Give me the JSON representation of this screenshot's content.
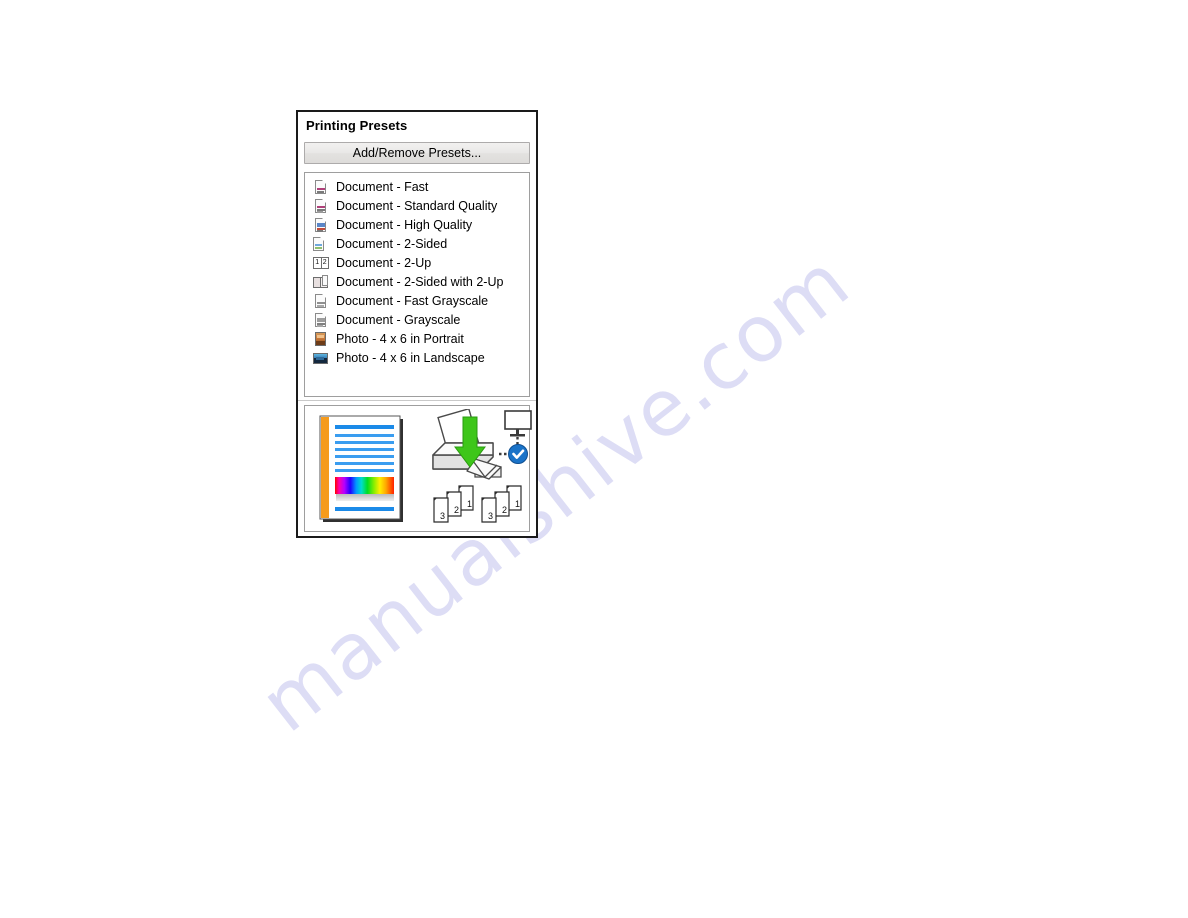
{
  "watermark": {
    "text": "manualshive.com",
    "color": "#ddddf5"
  },
  "dialog": {
    "title": "Printing Presets",
    "add_remove_button_label": "Add/Remove Presets...",
    "presets": [
      {
        "label": "Document - Fast",
        "icon": "document-fast-icon"
      },
      {
        "label": "Document - Standard Quality",
        "icon": "document-standard-quality-icon"
      },
      {
        "label": "Document - High Quality",
        "icon": "document-high-quality-icon"
      },
      {
        "label": "Document - 2-Sided",
        "icon": "document-2-sided-icon"
      },
      {
        "label": "Document - 2-Up",
        "icon": "document-2-up-icon"
      },
      {
        "label": "Document - 2-Sided with 2-Up",
        "icon": "document-2-sided-with-2-up-icon"
      },
      {
        "label": "Document - Fast Grayscale",
        "icon": "document-fast-grayscale-icon"
      },
      {
        "label": "Document - Grayscale",
        "icon": "document-grayscale-icon"
      },
      {
        "label": "Photo - 4 x 6 in Portrait",
        "icon": "photo-portrait-icon"
      },
      {
        "label": "Photo - 4 x 6 in Landscape",
        "icon": "photo-landscape-icon"
      }
    ],
    "preview": {
      "page_thumbnail": "color-document-page-preview",
      "printer": "printer-feeding-paper-icon",
      "monitor": "monitor-icon",
      "status": "connected-check-badge",
      "page_stack_left": "collated-pages-stack",
      "page_stack_right": "collated-pages-stack",
      "page_numbers": [
        "3",
        "2",
        "1"
      ]
    }
  },
  "colors": {
    "panel_border": "#1a1a1a",
    "button_face": "#e6e4e2",
    "listbox_border": "#9e9e9e",
    "accent_blue": "#1a73c8",
    "arrow_green": "#44cc22",
    "page_accent_orange": "#f59b1c",
    "text_line_blue": "#1b8ae8"
  }
}
